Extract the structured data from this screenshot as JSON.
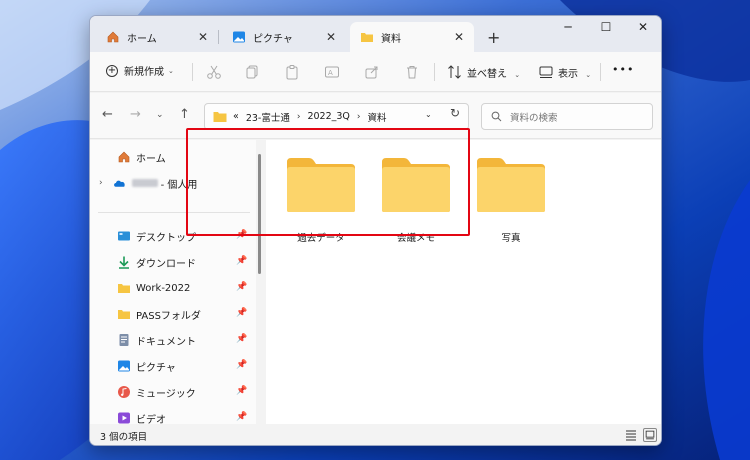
{
  "tabs": [
    {
      "label": "ホーム",
      "icon": "home-icon"
    },
    {
      "label": "ピクチャ",
      "icon": "pictures-icon"
    },
    {
      "label": "資料",
      "icon": "folder-icon",
      "active": true
    }
  ],
  "window_controls": {
    "minimize": "─",
    "maximize": "☐",
    "close": "✕"
  },
  "command_bar": {
    "new_label": "新規作成",
    "sort_label": "並べ替え",
    "view_label": "表示",
    "more_label": "•••",
    "icons": [
      "cut-icon",
      "copy-icon",
      "paste-icon",
      "rename-icon",
      "share-icon",
      "delete-icon"
    ]
  },
  "address": {
    "prefix": "«",
    "crumbs": [
      "23-富士通",
      "2022_3Q",
      "資料"
    ],
    "separator": "›"
  },
  "search": {
    "placeholder": "資料の検索"
  },
  "sidebar": {
    "items": [
      {
        "label": "ホーム",
        "icon": "home-icon",
        "pinned": false
      },
      {
        "label": "- 個人用",
        "icon": "onedrive-cloud-icon",
        "pinned": false,
        "blurred_name": true
      },
      {
        "label": "デスクトップ",
        "icon": "desktop-icon",
        "pinned": true
      },
      {
        "label": "ダウンロード",
        "icon": "download-icon",
        "pinned": true
      },
      {
        "label": "Work-2022",
        "icon": "folder-icon",
        "pinned": true
      },
      {
        "label": "PASSフォルダ",
        "icon": "folder-icon",
        "pinned": true
      },
      {
        "label": "ドキュメント",
        "icon": "documents-icon",
        "pinned": true
      },
      {
        "label": "ピクチャ",
        "icon": "pictures-icon",
        "pinned": true
      },
      {
        "label": "ミュージック",
        "icon": "music-icon",
        "pinned": true
      },
      {
        "label": "ビデオ",
        "icon": "video-icon",
        "pinned": true
      }
    ]
  },
  "folders": [
    {
      "name": "過去データ"
    },
    {
      "name": "会議メモ"
    },
    {
      "name": "写真"
    }
  ],
  "status": {
    "text": "3 個の項目"
  },
  "colors": {
    "highlight": "#e30613",
    "folder": "#f6c542",
    "accent": "#0067c0"
  }
}
